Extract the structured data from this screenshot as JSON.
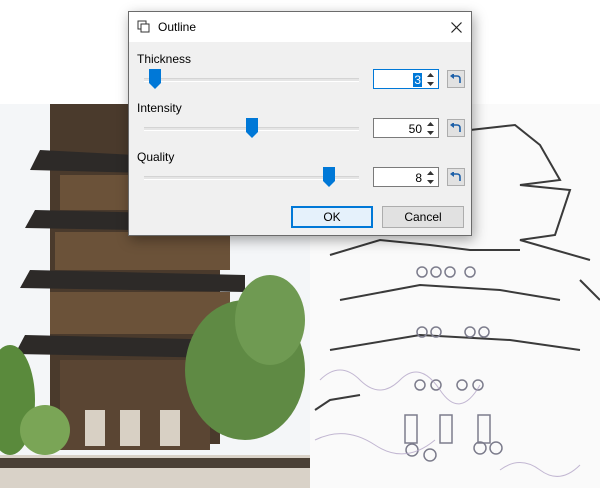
{
  "dialog": {
    "title": "Outline",
    "close_label": "Close",
    "ok_label": "OK",
    "cancel_label": "Cancel"
  },
  "params": [
    {
      "label": "Thickness",
      "value": "3",
      "level": 0.05,
      "focused": true
    },
    {
      "label": "Intensity",
      "value": "50",
      "level": 0.5,
      "focused": false
    },
    {
      "label": "Quality",
      "value": "8",
      "level": 0.86,
      "focused": false
    }
  ],
  "colors": {
    "accent": "#0078d7",
    "dialog_bg": "#f0f0f0",
    "reset_icon": "#1c5fa8"
  },
  "icons": {
    "title": "outline-effect-icon",
    "close": "close-icon",
    "reset": "reset-arrow-icon",
    "spin_up": "spin-up-icon",
    "spin_down": "spin-down-icon"
  }
}
